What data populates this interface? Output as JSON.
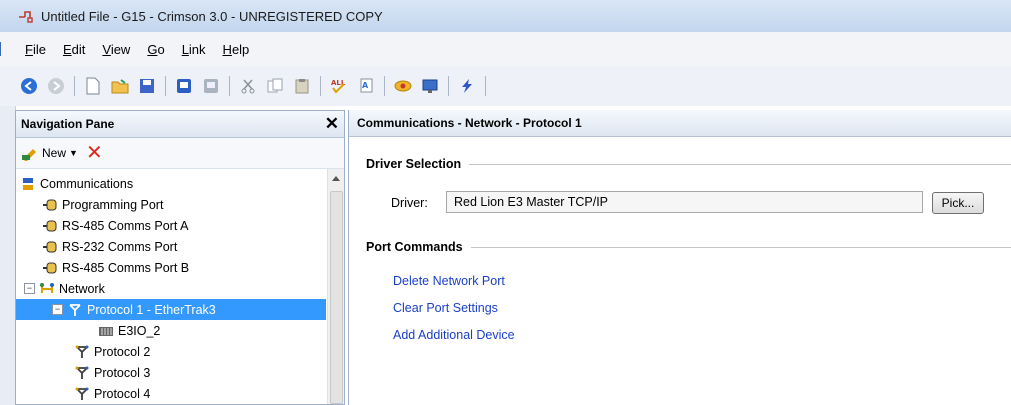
{
  "window": {
    "title": "Untitled File - G15 - Crimson 3.0 - UNREGISTERED COPY"
  },
  "menu": [
    {
      "label": "File",
      "key": "F",
      "rest": "ile"
    },
    {
      "label": "Edit",
      "key": "E",
      "rest": "dit"
    },
    {
      "label": "View",
      "key": "V",
      "rest": "iew"
    },
    {
      "label": "Go",
      "key": "G",
      "rest": "o"
    },
    {
      "label": "Link",
      "key": "L",
      "rest": "ink"
    },
    {
      "label": "Help",
      "key": "H",
      "rest": "elp"
    }
  ],
  "toolbar": {
    "icons": [
      "back-icon",
      "forward-icon",
      "new-file-icon",
      "open-folder-icon",
      "save-icon",
      "save-alt-icon",
      "window-icon",
      "cut-icon",
      "copy-icon",
      "paste-icon",
      "spell-check-icon",
      "find-replace-icon",
      "link-icon",
      "monitor-icon",
      "lightning-icon"
    ]
  },
  "nav_pane": {
    "title": "Navigation Pane",
    "new_label": "New",
    "tree": [
      {
        "label": "Communications",
        "level": 0,
        "icon": "communications-icon"
      },
      {
        "label": "Programming Port",
        "level": 1,
        "icon": "port-icon"
      },
      {
        "label": "RS-485 Comms Port A",
        "level": 1,
        "icon": "port-icon"
      },
      {
        "label": "RS-232 Comms Port",
        "level": 1,
        "icon": "port-icon"
      },
      {
        "label": "RS-485 Comms Port B",
        "level": 1,
        "icon": "port-icon"
      },
      {
        "label": "Network",
        "level": 0,
        "icon": "network-icon",
        "expander": "−"
      },
      {
        "label": "Protocol 1 - EtherTrak3",
        "level": 1,
        "icon": "protocol-icon",
        "expander": "−",
        "selected": true
      },
      {
        "label": "E3IO_2",
        "level": 2,
        "icon": "device-icon"
      },
      {
        "label": "Protocol 2",
        "level": 1,
        "icon": "protocol-icon"
      },
      {
        "label": "Protocol 3",
        "level": 1,
        "icon": "protocol-icon"
      },
      {
        "label": "Protocol 4",
        "level": 1,
        "icon": "protocol-icon"
      }
    ]
  },
  "content": {
    "header": "Communications - Network - Protocol 1",
    "driver_section": "Driver Selection",
    "driver_label": "Driver:",
    "driver_value": "Red Lion E3 Master TCP/IP",
    "pick_label": "Pick...",
    "port_section": "Port Commands",
    "commands": [
      "Delete Network Port",
      "Clear Port Settings",
      "Add Additional Device"
    ]
  },
  "colors": {
    "selection": "#3399ff",
    "link": "#1a3fc7"
  }
}
